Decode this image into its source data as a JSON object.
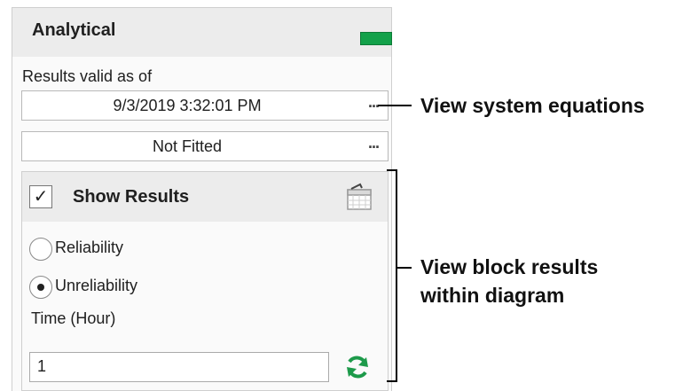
{
  "panel": {
    "title": "Analytical",
    "status_color": "#13a14a",
    "results_valid_label": "Results valid as of",
    "timestamp": "9/3/2019 3:32:01 PM",
    "fit_status": "Not Fitted",
    "ellipsis": "..."
  },
  "results": {
    "show_results_label": "Show Results",
    "show_results_checked": true,
    "checkmark": "✓",
    "options": [
      {
        "label": "Reliability",
        "selected": false
      },
      {
        "label": "Unreliability",
        "selected": true
      }
    ],
    "time_label": "Time (Hour)",
    "time_value": "1"
  },
  "annotations": {
    "equations": "View system equations",
    "block_results_line1": "View block results",
    "block_results_line2": "within diagram"
  },
  "icons": {
    "calendar": "calendar-icon",
    "refresh": "refresh-icon"
  }
}
